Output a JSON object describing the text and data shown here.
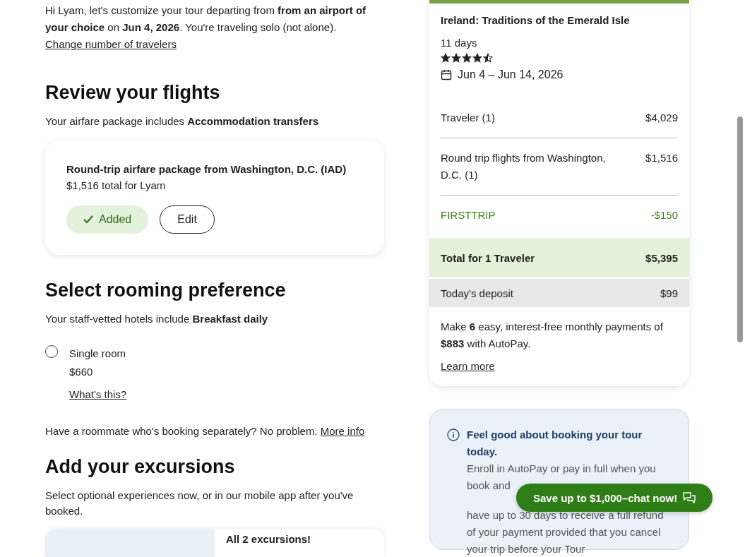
{
  "intro": {
    "text": "Hi Lyam, let's customize your tour departing from **from an airport of your choice** on **Jun 4, 2026**. You're traveling solo (not alone).",
    "link": "Change number of travelers"
  },
  "flights": {
    "heading": "Review your flights",
    "subtitle": "Your airfare package includes **Accommodation transfers**",
    "package": {
      "title": "Round-trip airfare package from Washington, D.C. (IAD)",
      "subtitle": "$1,516 total for Lyam",
      "added": true,
      "added_label": "Added",
      "edit_label": "Edit"
    }
  },
  "rooming": {
    "heading": "Select rooming preference",
    "subtitle": "Your staff-vetted hotels include **Breakfast daily**",
    "options": [
      {
        "label": "Single room",
        "price": "$660",
        "help_link": "What's this?",
        "selected": false
      }
    ],
    "roommate_text": "Have a roommate who's booking separately? No problem.",
    "roommate_link": "More info"
  },
  "excursions": {
    "heading": "Add your excursions",
    "subtitle": "Select optional experiences now, or in our mobile app after you've booked.",
    "card_title": "All 2 excursions!"
  },
  "summary": {
    "title": "Ireland: Traditions of the Emerald Isle",
    "duration": "11 days",
    "stars": 4.5,
    "dates": "Jun 4 – Jun 14, 2026",
    "lines": [
      {
        "label": "Traveler (1)",
        "amount": "$4,029",
        "kind": "charge"
      },
      {
        "label": "Round trip flights from Washington, D.C. (1)",
        "amount": "$1,516",
        "kind": "charge"
      },
      {
        "label": "FIRSTTRIP",
        "amount": "-$150",
        "kind": "discount"
      }
    ],
    "total": {
      "label": "Total for 1 Traveler",
      "amount": "$5,395"
    },
    "deposit": {
      "label": "Today's deposit",
      "amount": "$99"
    },
    "payment_text": "Make **6** easy, interest-free monthly payments of **$883** with AutoPay.",
    "learn_more": "Learn more"
  },
  "info": {
    "title": "Feel good about booking your tour today.",
    "text_1": "Enroll in AutoPay or pay in full when you book and",
    "text_2": "have up to 30 days to receive a full refund of your payment provided that you cancel your trip before your Tour"
  },
  "chat_button": "Save up to $1,000–chat now!"
}
